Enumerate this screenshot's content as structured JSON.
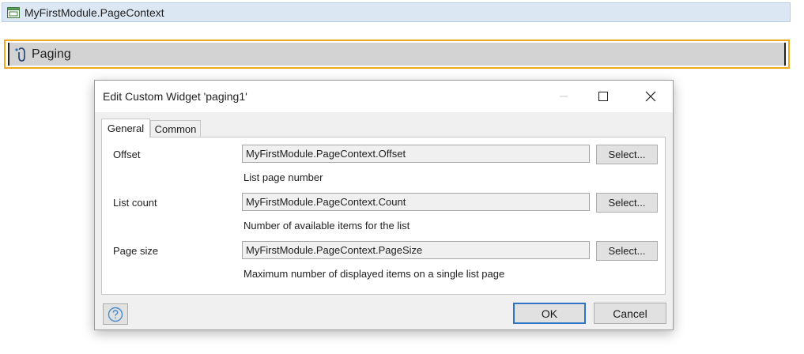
{
  "context_bar": {
    "label": "MyFirstModule.PageContext"
  },
  "paging_widget": {
    "label": "Paging"
  },
  "dialog": {
    "title": "Edit Custom Widget 'paging1'",
    "tabs": [
      "General",
      "Common"
    ],
    "active_tab": "General",
    "rows": [
      {
        "label": "Offset",
        "value": "MyFirstModule.PageContext.Offset",
        "button": "Select...",
        "hint": "List page number"
      },
      {
        "label": "List count",
        "value": "MyFirstModule.PageContext.Count",
        "button": "Select...",
        "hint": "Number of available items for the list"
      },
      {
        "label": "Page size",
        "value": "MyFirstModule.PageContext.PageSize",
        "button": "Select...",
        "hint": "Maximum number of displayed items on a single list page"
      }
    ],
    "ok_label": "OK",
    "cancel_label": "Cancel"
  },
  "colors": {
    "selection_border": "#f0a81c",
    "context_bar_bg": "#dbe7f3",
    "ok_focus": "#2f74c8"
  },
  "icons": {
    "context": "page-window-icon",
    "paging": "paging-widget-icon",
    "help": "help-question-icon",
    "minimize": "minimize-icon",
    "maximize": "maximize-icon",
    "close": "close-icon"
  }
}
